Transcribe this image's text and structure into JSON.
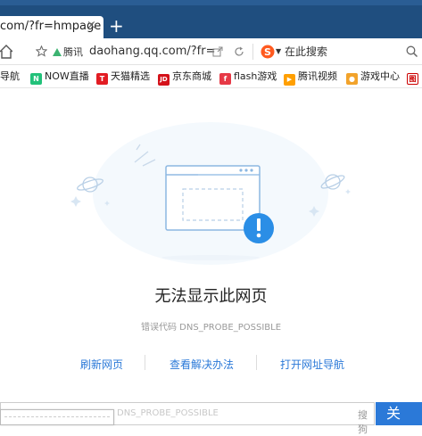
{
  "tab": {
    "title": "com/?fr=hmpage",
    "close": "×",
    "new_tab": "+"
  },
  "address": {
    "logo_label": "腾讯",
    "url": "daohang.qq.com/?fr=",
    "search_placeholder": "在此搜索"
  },
  "bookmarks": [
    {
      "label": "导航",
      "color": "#ff7a00",
      "glyph": ""
    },
    {
      "label": "NOW直播",
      "color": "#22c17a",
      "glyph": "N"
    },
    {
      "label": "天猫精选",
      "color": "#e21c23",
      "glyph": "T"
    },
    {
      "label": "京东商城",
      "color": "#d4121a",
      "glyph": "JD"
    },
    {
      "label": "flash游戏",
      "color": "#e63946",
      "glyph": "f"
    },
    {
      "label": "腾讯视频",
      "color": "#ff9f00",
      "glyph": "▶"
    },
    {
      "label": "游戏中心",
      "color": "#f2a32b",
      "glyph": "●"
    },
    {
      "label": "",
      "color": "#c00",
      "glyph": "图"
    }
  ],
  "error": {
    "title": "无法显示此网页",
    "code": "错误代码 DNS_PROBE_POSSIBLE"
  },
  "actions": [
    {
      "label": "刷新网页"
    },
    {
      "label": "查看解决办法"
    },
    {
      "label": "打开网址导航"
    }
  ],
  "bottom": {
    "input_text": "DNS_PROBE_POSSIBLE",
    "dropdown_label": "搜狗",
    "button_char": "关"
  },
  "colors": {
    "accent": "#2b79d8",
    "tabbar": "#1f4e7f"
  }
}
